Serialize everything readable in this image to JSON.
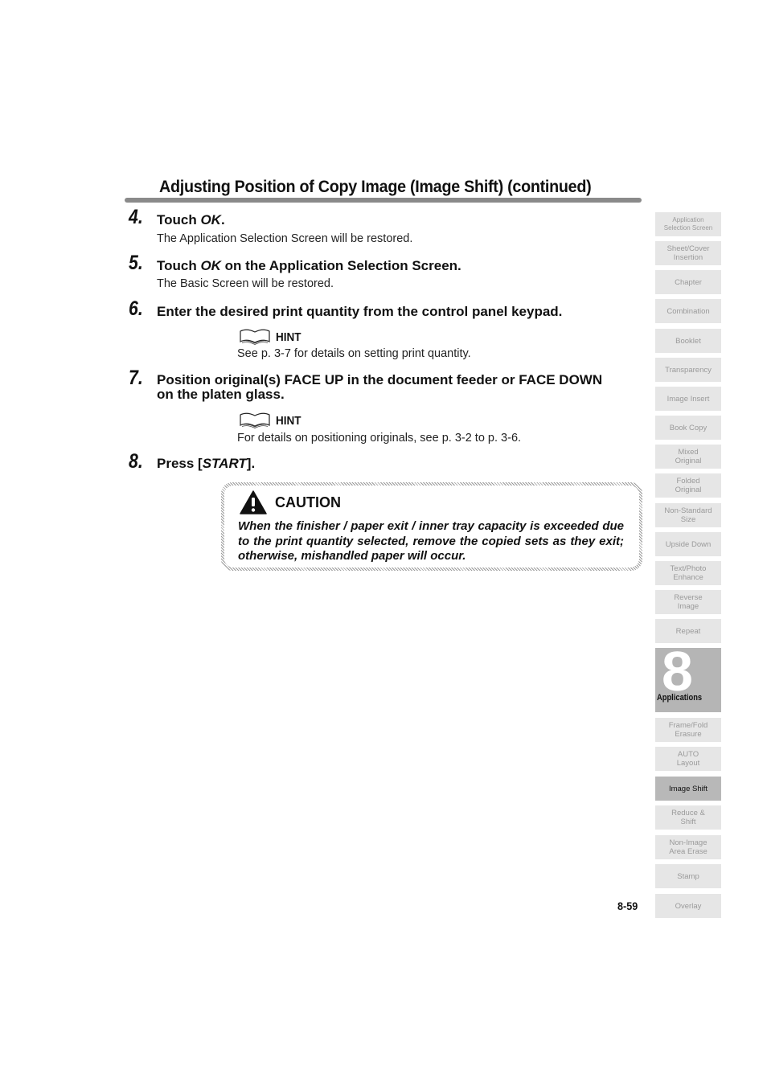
{
  "header": {
    "title": "Adjusting Position of Copy Image (Image Shift) (continued)"
  },
  "steps": [
    {
      "number": "4.",
      "pre": "Touch ",
      "em": "OK",
      "post": ".",
      "sub": "The Application Selection Screen will be restored."
    },
    {
      "number": "5.",
      "pre": "Touch ",
      "em": "OK",
      "post": " on the Application Selection Screen.",
      "sub": "The Basic Screen will be restored."
    },
    {
      "number": "6.",
      "text": "Enter the desired print quantity from the control panel keypad."
    },
    {
      "number": "7.",
      "line1": "Position original(s) FACE UP in the document feeder or FACE DOWN",
      "line2": "on the platen glass."
    },
    {
      "number": "8.",
      "pre": "Press [",
      "em": "START",
      "post": "]."
    }
  ],
  "hints": [
    {
      "label": "HINT",
      "icon": "book-icon",
      "text": "See p. 3-7 for details on setting print quantity."
    },
    {
      "label": "HINT",
      "icon": "book-icon",
      "text": "For details on positioning originals, see p. 3-2 to p. 3-6."
    }
  ],
  "caution": {
    "label": "CAUTION",
    "icon": "warning-icon",
    "text": "When the finisher / paper exit / inner tray capacity is exceeded due to the print quantity selected, remove the copied sets as they exit; otherwise, mishandled paper will occur."
  },
  "footer": {
    "page_number": "8-59"
  },
  "chapter": {
    "number": "8",
    "label": "Applications"
  },
  "side_tabs": [
    {
      "line1": "Application",
      "line2": "Selection Screen"
    },
    {
      "line1": "Sheet/Cover",
      "line2": "Insertion"
    },
    {
      "line1": "Chapter",
      "line2": ""
    },
    {
      "line1": "Combination",
      "line2": ""
    },
    {
      "line1": "Booklet",
      "line2": ""
    },
    {
      "line1": "Transparency",
      "line2": ""
    },
    {
      "line1": "Image Insert",
      "line2": ""
    },
    {
      "line1": "Book Copy",
      "line2": ""
    },
    {
      "line1": "Mixed",
      "line2": "Original"
    },
    {
      "line1": "Folded",
      "line2": "Original"
    },
    {
      "line1": "Non-Standard",
      "line2": "Size"
    },
    {
      "line1": "Upside Down",
      "line2": ""
    },
    {
      "line1": "Text/Photo",
      "line2": "Enhance"
    },
    {
      "line1": "Reverse",
      "line2": "Image"
    },
    {
      "line1": "Repeat",
      "line2": ""
    },
    {
      "line1": "Frame/Fold",
      "line2": "Erasure"
    },
    {
      "line1": "AUTO",
      "line2": "Layout"
    },
    {
      "line1": "Image Shift",
      "line2": "",
      "active": true
    },
    {
      "line1": "Reduce &",
      "line2": "Shift"
    },
    {
      "line1": "Non-Image",
      "line2": "Area Erase"
    },
    {
      "line1": "Stamp",
      "line2": ""
    },
    {
      "line1": "Overlay",
      "line2": ""
    }
  ]
}
